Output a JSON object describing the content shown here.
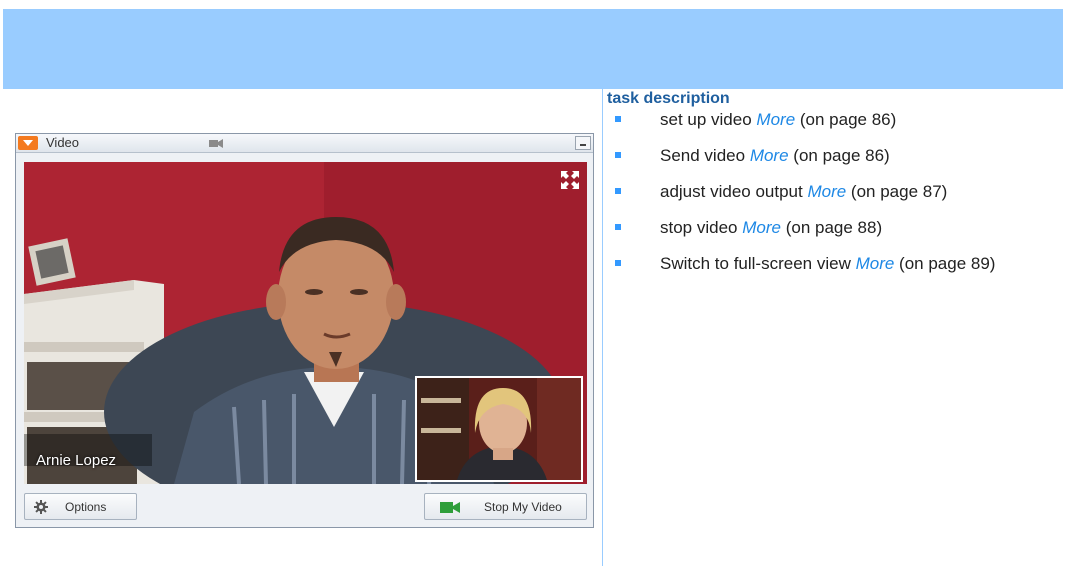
{
  "header": {
    "title": "task description"
  },
  "colors": {
    "header_bg": "#99ccff",
    "accent": "#1e88e5",
    "bullet": "#3399ff"
  },
  "video_window": {
    "title": "Video",
    "participant_name": "Arnie Lopez",
    "options_label": "Options",
    "stop_video_label": "Stop My Video"
  },
  "tasks": [
    {
      "text": "set up video",
      "link": "More",
      "ref": "(on page 86)"
    },
    {
      "text": "Send video",
      "link": "More",
      "ref": "(on page 86)"
    },
    {
      "text": "adjust video output",
      "link": "More",
      "ref": "(on page 87)"
    },
    {
      "text": "stop video",
      "link": "More",
      "ref": "(on page 88)"
    },
    {
      "text": "Switch to full-screen view",
      "link": "More",
      "ref": "(on page 89)"
    }
  ]
}
